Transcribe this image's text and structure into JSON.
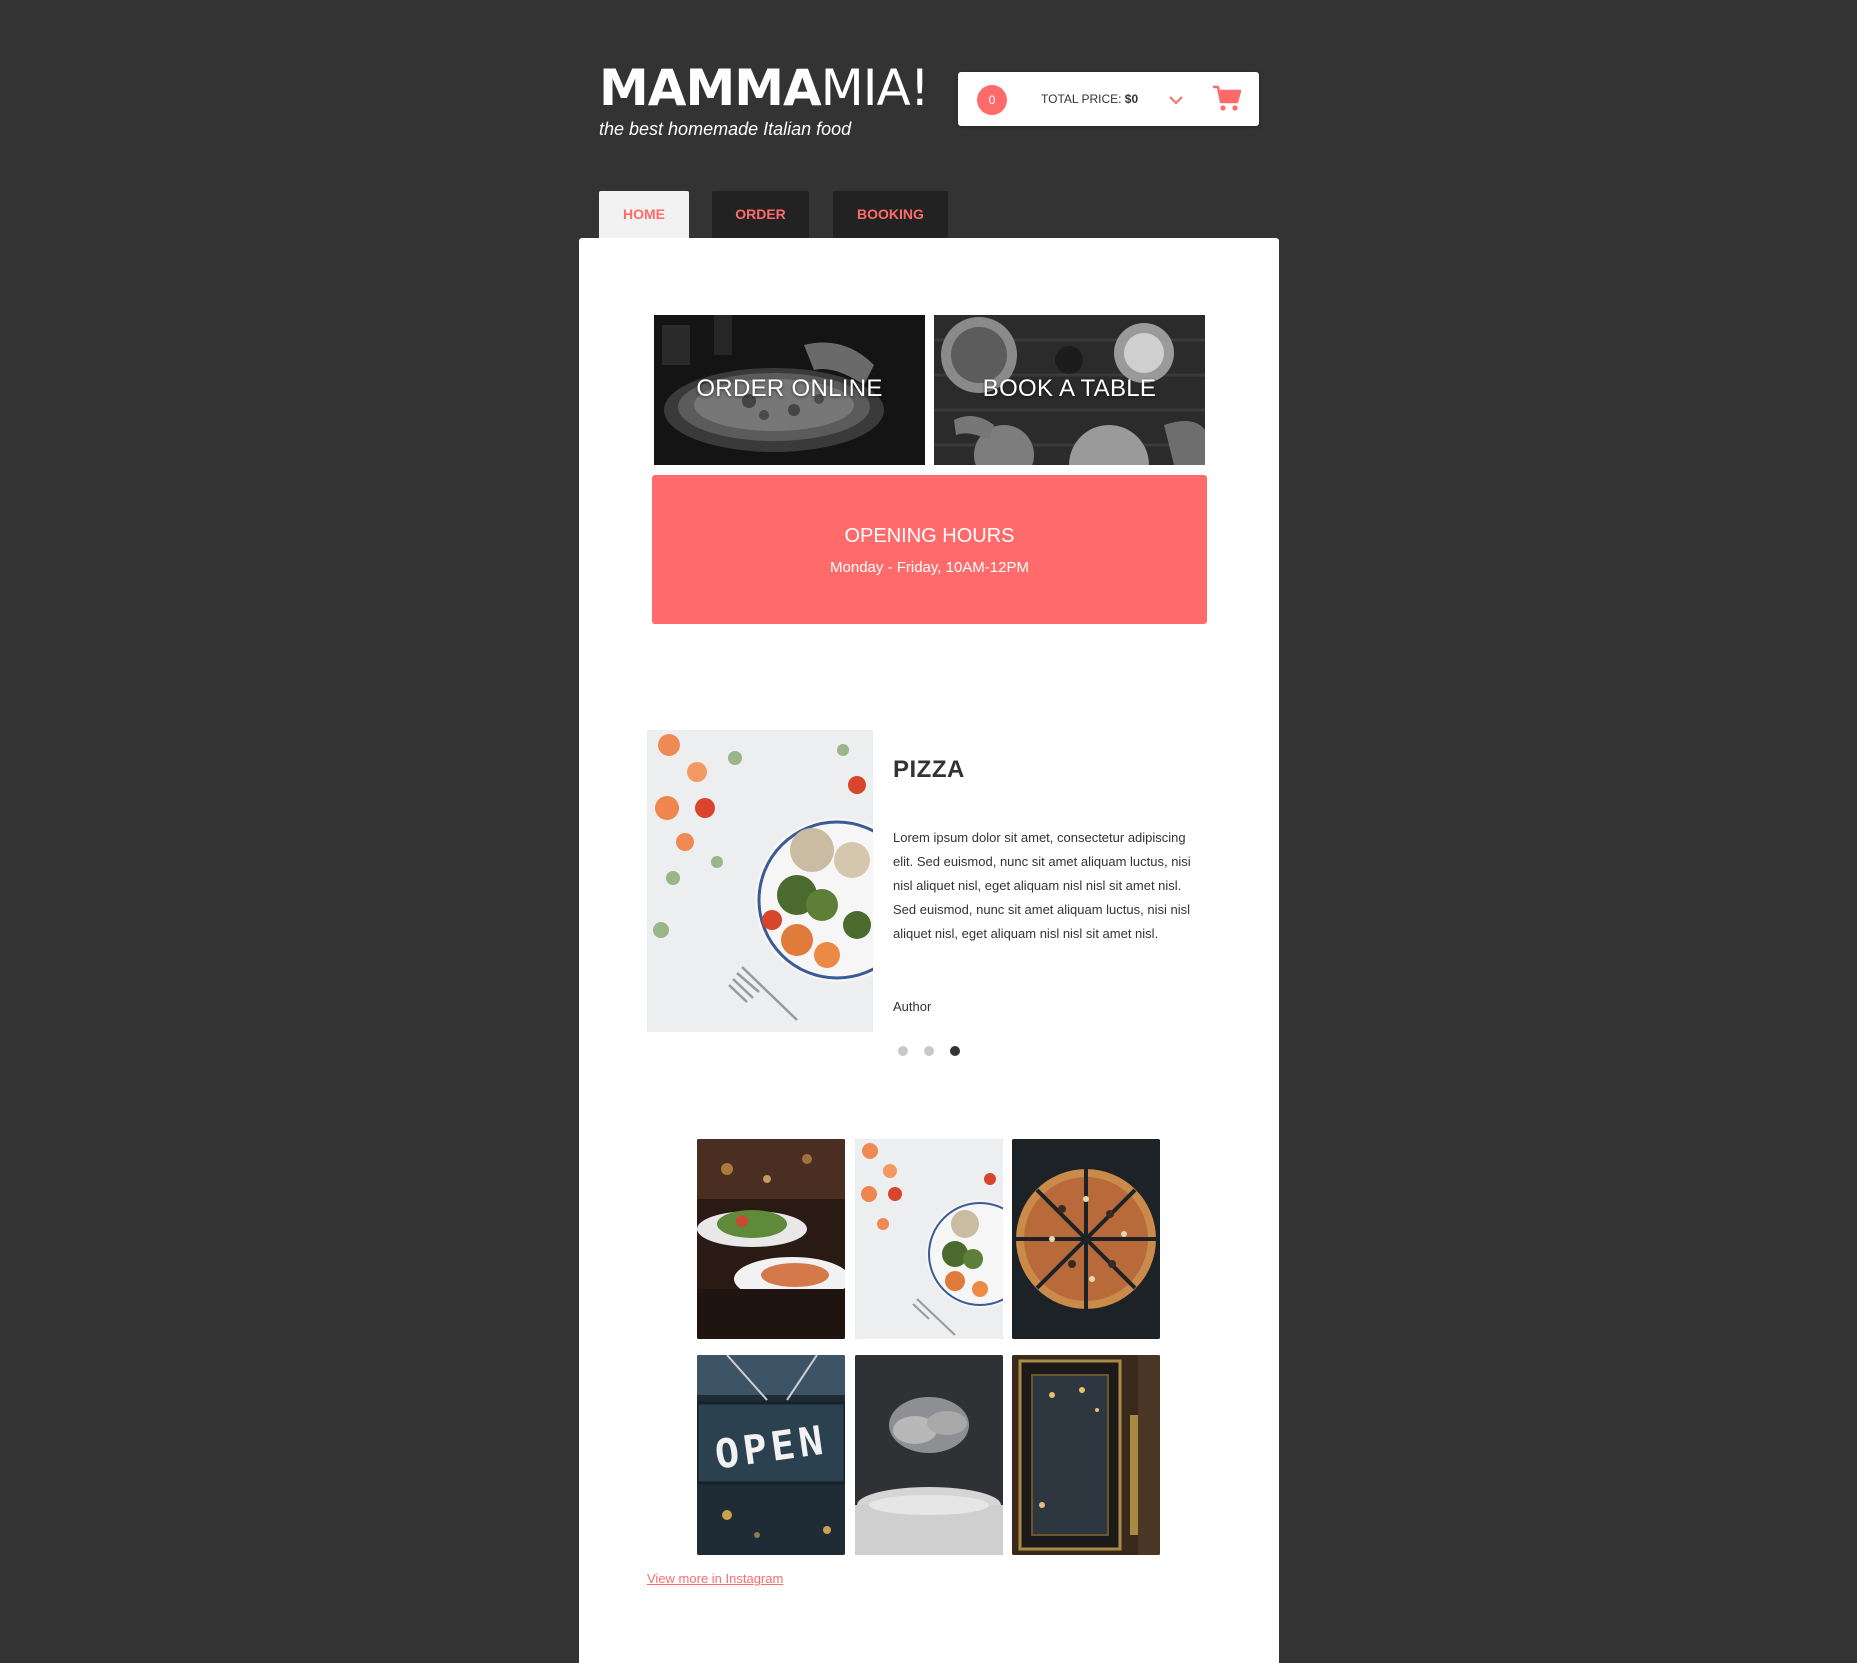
{
  "header": {
    "logo_bold": "MAMMA",
    "logo_light": "MIA!",
    "tagline": "the best homemade Italian food"
  },
  "cart": {
    "count": "0",
    "total_label": "TOTAL PRICE: ",
    "total_amount": "$0"
  },
  "nav": {
    "tabs": [
      {
        "label": "HOME",
        "active": true
      },
      {
        "label": "ORDER",
        "active": false
      },
      {
        "label": "BOOKING",
        "active": false
      }
    ]
  },
  "tiles": {
    "order_label": "ORDER ONLINE",
    "book_label": "BOOK A TABLE"
  },
  "hours": {
    "title": "OPENING HOURS",
    "text": "Monday - Friday, 10AM-12PM"
  },
  "carousel": {
    "title": "PIZZA",
    "text": "Lorem ipsum dolor sit amet, consectetur adipiscing elit. Sed euismod, nunc sit amet aliquam luctus, nisi nisl aliquet nisl, eget aliquam nisl nisl sit amet nisl. Sed euismod, nunc sit amet aliquam luctus, nisi nisl aliquet nisl, eget aliquam nisl nisl sit amet nisl.",
    "author": "Author",
    "slide_count": 3,
    "active_slide": 3
  },
  "gallery": {
    "open_sign_text": "OPEN",
    "link_label": "View more in Instagram"
  },
  "colors": {
    "accent": "#ff6b6b",
    "background": "#333333",
    "card": "#ffffff"
  },
  "icons": [
    "cart-icon",
    "chevron-down-icon"
  ]
}
